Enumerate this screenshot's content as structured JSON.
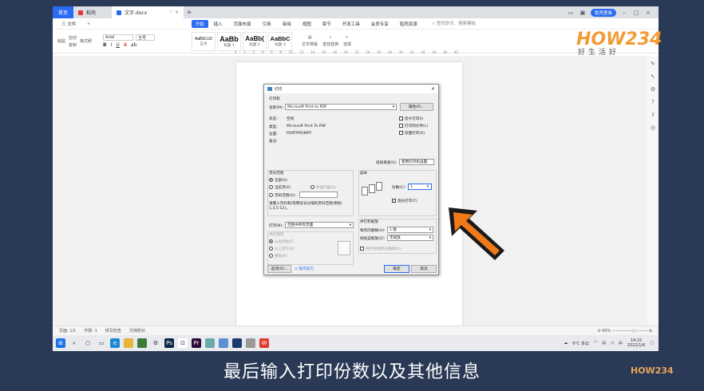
{
  "browser": {
    "tabs": [
      {
        "label": "首页"
      },
      {
        "label": "稻壳"
      },
      {
        "label": "文字.docx"
      }
    ],
    "login_label": "稻壳登录"
  },
  "menu": {
    "items": [
      "开始",
      "插入",
      "页面布局",
      "引用",
      "审阅",
      "视图",
      "章节",
      "开发工具",
      "会员专享",
      "稻壳资源"
    ],
    "search": "查找命令、搜索模板",
    "left": [
      "三 文件",
      "«"
    ]
  },
  "ribbon": {
    "paste": "粘贴",
    "cut": "剪切",
    "copy": "复制",
    "format_painter": "格式刷",
    "font": "Arial",
    "size": "五号",
    "styles": [
      {
        "sample": "AaBbCcD",
        "name": "正文"
      },
      {
        "sample": "AaBb",
        "name": "标题 1"
      },
      {
        "sample": "AaBb(",
        "name": "标题 2"
      },
      {
        "sample": "AaBbC",
        "name": "标题 3"
      }
    ],
    "text_layout": "文字排版",
    "find_replace": "查找替换",
    "select": "选择"
  },
  "dialog": {
    "title": "打印",
    "printer_section": "打印机",
    "name_label": "名称(M):",
    "printer_name": "Microsoft Print to PDF",
    "properties_btn": "属性(P)...",
    "status_label": "状态:",
    "status_value": "空闲",
    "type_label": "类型:",
    "type_value": "Microsoft Print To PDF",
    "where_label": "位置:",
    "where_value": "PORTPROMPT:",
    "comment_label": "备注:",
    "reverse_print": "反片打印(I)",
    "print_to_file": "打印到文件(L)",
    "duplex": "双面打印(X)",
    "paper_source_label": "纸张来源(S):",
    "paper_source_value": "使用打印机设置",
    "range_section": "页码范围",
    "all": "全部(A)",
    "current_page": "当前页(E)",
    "selection": "所选内容(S)",
    "pages": "页码范围(G):",
    "range_hint": "请键入页码和/或用逗号分隔的页码范围(例如: 1,3,5-12)。",
    "print_label": "打印(N):",
    "print_value": "范围中所有页面",
    "order_section": "并打顺序",
    "order_lr": "从左到右(F)",
    "order_tb": "从上到下(B)",
    "order_repeat": "重复(R)",
    "copies_section": "副本",
    "copies_label": "份数(C):",
    "copies_value": "1",
    "collate": "逐份打印(T)",
    "scale_section": "并打和缩放",
    "per_sheet_label": "每页的版数(H):",
    "per_sheet_value": "1 版",
    "scale_label": "按纸型缩放(Z):",
    "scale_value": "无缩放",
    "scale_note": "并打时绘制分隔线(D)",
    "options_btn": "选项(O)...",
    "tips": "操作技巧",
    "ok_btn": "确定",
    "cancel_btn": "取消"
  },
  "status": {
    "page": "页面: 1/1",
    "words": "字数: 1",
    "spell": "拼写检查",
    "proof": "文档校对",
    "zoom": "90%"
  },
  "taskbar": {
    "weather": "6°C 多云",
    "time": "14:15",
    "date": "2022/1/6"
  },
  "logo": {
    "text": "HOW234",
    "sub": "好生活好"
  },
  "caption": "最后输入打印份数以及其他信息",
  "watermark": "HOW234",
  "colors": {
    "accent": "#2b6bf3",
    "arrow": "#f07a1a"
  }
}
